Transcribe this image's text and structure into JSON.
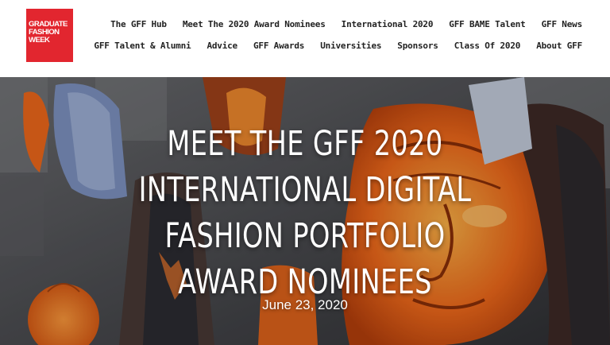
{
  "logo": {
    "text": "GRADUATE\nFASHION\nWEEK",
    "color": "#e2262f"
  },
  "nav": {
    "row1": [
      "The GFF Hub",
      "Meet The 2020 Award Nominees",
      "International 2020",
      "GFF BAME Talent",
      "GFF News"
    ],
    "row2": [
      "GFF Talent & Alumni",
      "Advice",
      "GFF Awards",
      "Universities",
      "Sponsors",
      "Class Of 2020",
      "About GFF"
    ]
  },
  "hero": {
    "title_lines": [
      "MEET THE GFF 2020",
      "INTERNATIONAL DIGITAL",
      "FASHION PORTFOLIO",
      "AWARD NOMINEES"
    ],
    "date": "June 23, 2020"
  },
  "colors": {
    "accent_orange": "#f26a1b",
    "text": "#222222"
  }
}
